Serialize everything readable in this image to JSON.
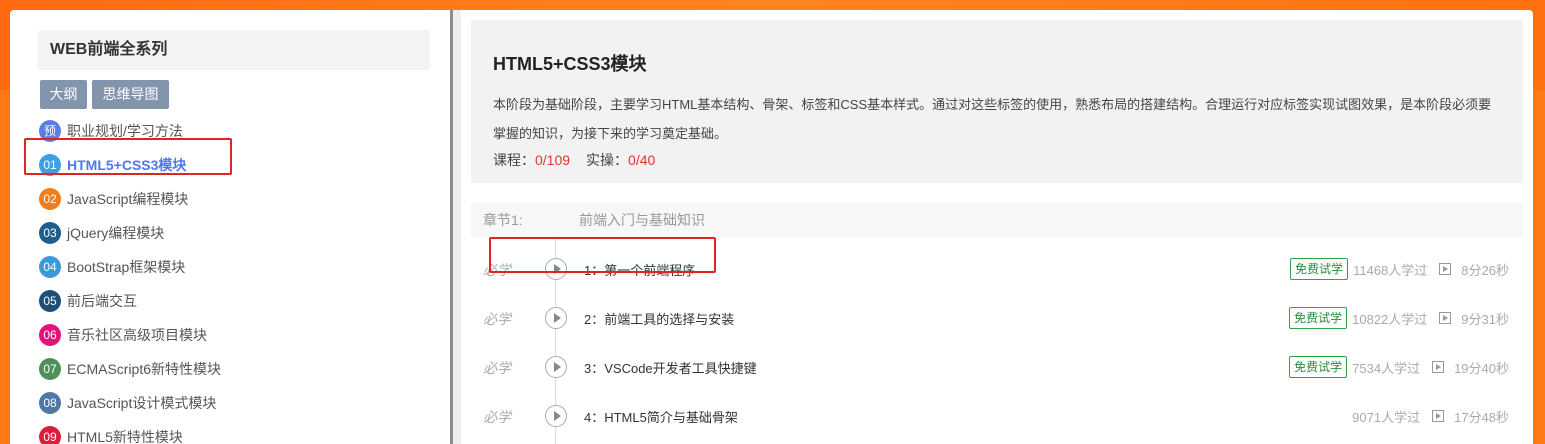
{
  "sidebar": {
    "title": "WEB前端全系列",
    "buttons": {
      "outline": "大纲",
      "mindmap": "思维导图"
    },
    "modules": [
      {
        "num": "预",
        "label": "职业规划/学习方法",
        "color": "#5a7ee6"
      },
      {
        "num": "01",
        "label": "HTML5+CSS3模块",
        "color": "#3ba0e6",
        "active": true
      },
      {
        "num": "02",
        "label": "JavaScript编程模块",
        "color": "#f07d1a"
      },
      {
        "num": "03",
        "label": "jQuery编程模块",
        "color": "#1f5e8c"
      },
      {
        "num": "04",
        "label": "BootStrap框架模块",
        "color": "#3a9ad9"
      },
      {
        "num": "05",
        "label": "前后端交互",
        "color": "#1c4f7a"
      },
      {
        "num": "06",
        "label": "音乐社区高级项目模块",
        "color": "#e4127a"
      },
      {
        "num": "07",
        "label": "ECMAScript6新特性模块",
        "color": "#4f8f5a"
      },
      {
        "num": "08",
        "label": "JavaScript设计模式模块",
        "color": "#4f78a8"
      },
      {
        "num": "09",
        "label": "HTML5新特性模块",
        "color": "#d81e3a"
      }
    ]
  },
  "intro": {
    "title": "HTML5+CSS3模块",
    "description": "本阶段为基础阶段，主要学习HTML基本结构、骨架、标签和CSS基本样式。通过对这些标签的使用，熟悉布局的搭建结构。合理运行对应标签实现试图效果，是本阶段必须要掌握的知识，为接下来的学习奠定基础。",
    "course_label": "课程：",
    "course_value": "0/109",
    "practice_label": "实操：",
    "practice_value": "0/40"
  },
  "chapter": {
    "label": "章节1:",
    "name": "前端入门与基础知识"
  },
  "lessons": [
    {
      "required": "必学",
      "title": "1：第一个前端程序",
      "badge": "免费试学",
      "learners": "11468人学过",
      "duration": "8分26秒"
    },
    {
      "required": "必学",
      "title": "2：前端工具的选择与安装",
      "badge": "免费试学",
      "learners": "10822人学过",
      "duration": "9分31秒"
    },
    {
      "required": "必学",
      "title": "3：VSCode开发者工具快捷键",
      "badge": "免费试学",
      "learners": "7534人学过",
      "duration": "19分40秒"
    },
    {
      "required": "必学",
      "title": "4：HTML5简介与基础骨架",
      "badge": "",
      "learners": "9071人学过",
      "duration": "17分48秒"
    }
  ]
}
